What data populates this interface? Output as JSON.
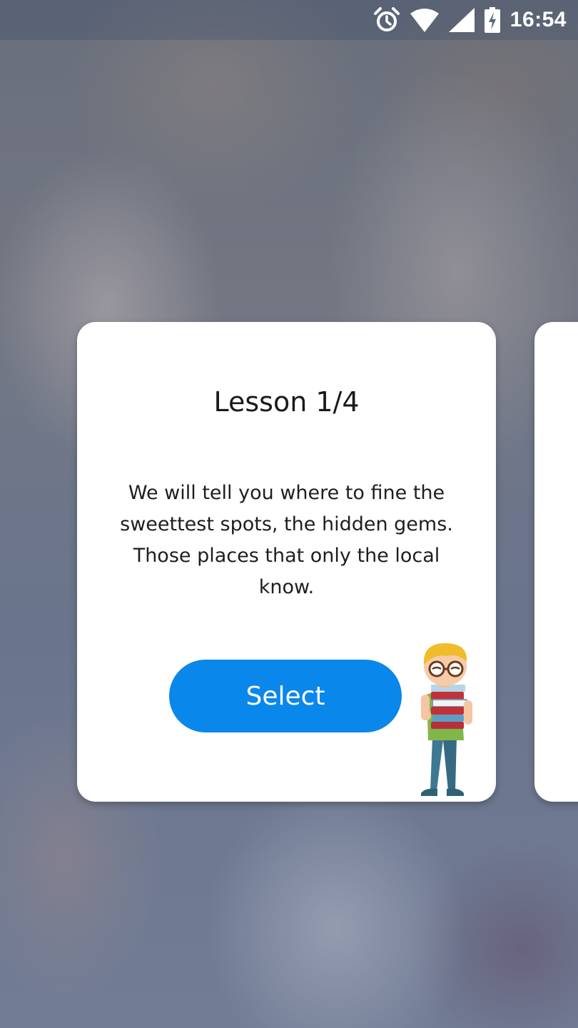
{
  "status_bar": {
    "time": "16:54",
    "icons": [
      "alarm-icon",
      "wifi-icon",
      "cell-signal-icon",
      "battery-charging-icon"
    ]
  },
  "lesson_card": {
    "title": "Lesson 1/4",
    "description": "We will tell you where to fine the sweettest spots, the hidden gems. Those places that only the local know.",
    "button_label": "Select",
    "button_color": "#0a87eb"
  },
  "mascot": {
    "icon": "student-with-books-illustration"
  }
}
